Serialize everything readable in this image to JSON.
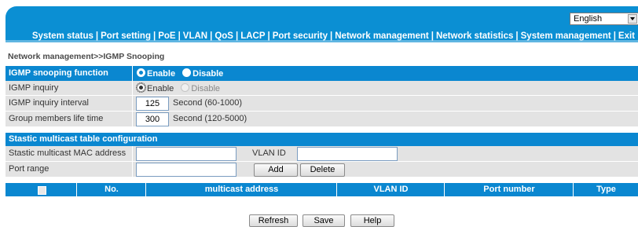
{
  "header": {
    "language": "English",
    "nav": [
      "System status",
      "Port setting",
      "PoE",
      "VLAN",
      "QoS",
      "LACP",
      "Port security",
      "Network management",
      "Network statistics",
      "System management",
      "Exit"
    ],
    "nav_separator": "|"
  },
  "breadcrumb": "Network management>>IGMP Snooping",
  "igmp": {
    "function_label": "IGMP snooping function",
    "function_enable": "Enable",
    "function_disable": "Disable",
    "inquiry_label": "IGMP inquiry",
    "inquiry_enable": "Enable",
    "inquiry_disable": "Disable",
    "interval_label": "IGMP inquiry interval",
    "interval_value": "125",
    "interval_unit": "Second (60-1000)",
    "lifetime_label": "Group members life time",
    "lifetime_value": "300",
    "lifetime_unit": "Second (120-5000)"
  },
  "static": {
    "section_title": "Stastic multicast table configuration",
    "mac_label": "Stastic multicast MAC address",
    "vlan_label": "VLAN ID",
    "port_range_label": "Port range",
    "add_label": "Add",
    "delete_label": "Delete"
  },
  "table": {
    "columns": [
      "No.",
      "multicast address",
      "VLAN ID",
      "Port number",
      "Type"
    ]
  },
  "footer": {
    "refresh_label": "Refresh",
    "save_label": "Save",
    "help_label": "Help"
  },
  "colors": {
    "accent": "#0a87d0",
    "row_bg": "#e3e3e3"
  }
}
